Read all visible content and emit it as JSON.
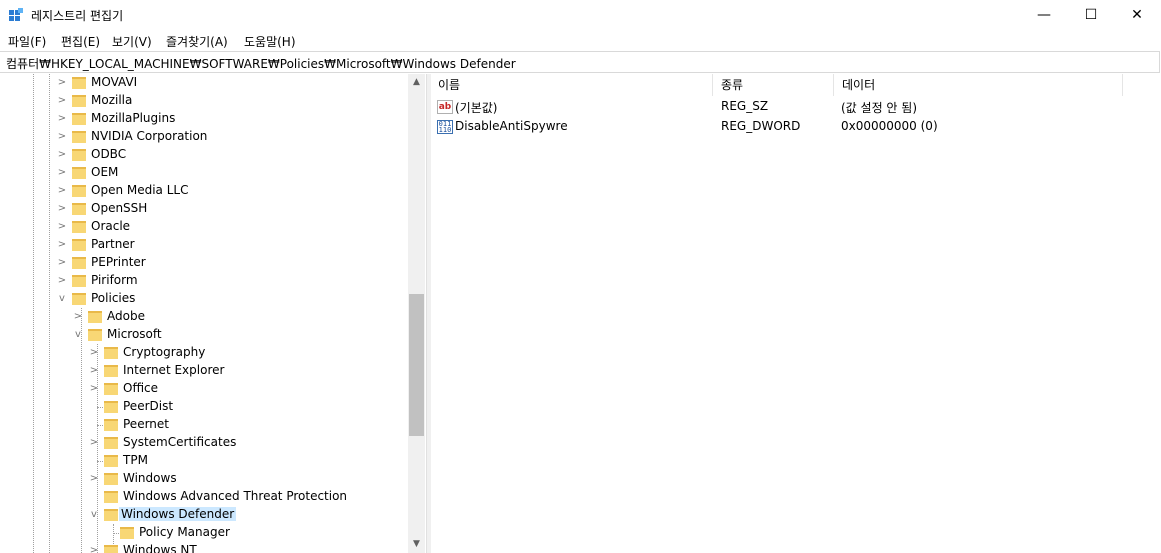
{
  "window": {
    "title": "레지스트리 편집기",
    "minimize": "—",
    "maximize": "☐",
    "close": "✕"
  },
  "menu": [
    "파일(F)",
    "편집(E)",
    "보기(V)",
    "즐겨찾기(A)",
    "도움말(H)"
  ],
  "address": "컴퓨터₩HKEY_LOCAL_MACHINE₩SOFTWARE₩Policies₩Microsoft₩Windows Defender",
  "tree": {
    "level1": [
      "MOVAVI",
      "Mozilla",
      "MozillaPlugins",
      "NVIDIA Corporation",
      "ODBC",
      "OEM",
      "Open Media LLC",
      "OpenSSH",
      "Oracle",
      "Partner",
      "PEPrinter",
      "Piriform",
      "Policies"
    ],
    "level2": [
      "Adobe",
      "Microsoft"
    ],
    "level3": [
      "Cryptography",
      "Internet Explorer",
      "Office",
      "PeerDist",
      "Peernet",
      "SystemCertificates",
      "TPM",
      "Windows",
      "Windows Advanced Threat Protection",
      "Windows Defender",
      "Windows NT"
    ],
    "level4": [
      "Policy Manager"
    ],
    "selected": "Windows Defender"
  },
  "list": {
    "columns": [
      "이름",
      "종류",
      "데이터"
    ],
    "rows": [
      {
        "name": "(기본값)",
        "type": "REG_SZ",
        "data": "(값 설정 안 됨)",
        "icon": "string-value-icon"
      },
      {
        "name": "DisableAntiSpywre",
        "type": "REG_DWORD",
        "data": "0x00000000 (0)",
        "icon": "binary-value-icon"
      }
    ]
  },
  "colors": {
    "folder": "#f8d775",
    "selection": "#cce8ff",
    "scrollbar": "#c1c1c1"
  }
}
